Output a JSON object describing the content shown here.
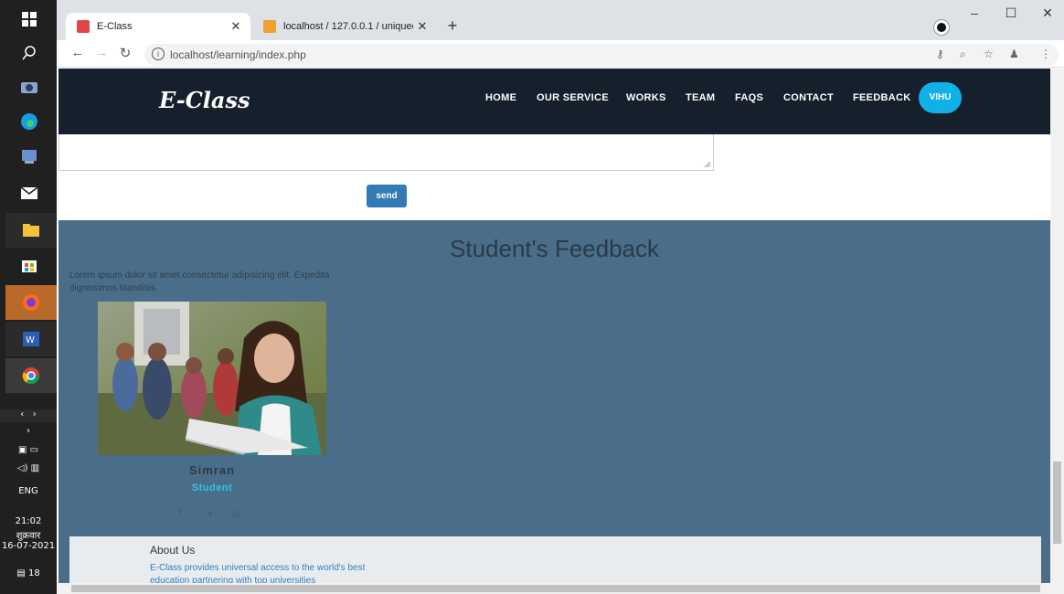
{
  "taskbar": {
    "icons": [
      "windows-icon",
      "search-icon",
      "camera-icon",
      "edge-icon",
      "app-icon",
      "mail-icon",
      "file-explorer-icon",
      "store-icon",
      "firefox-icon",
      "word-icon",
      "chrome-icon"
    ],
    "language": "ENG",
    "time": "21:02",
    "day": "शुक्रवार",
    "date": "16-07-2021",
    "notification_count": "18"
  },
  "browser": {
    "tabs": [
      {
        "title": "E-Class",
        "active": true
      },
      {
        "title": "localhost / 127.0.0.1 / uniquede…",
        "active": false
      }
    ],
    "url": "localhost/learning/index.php"
  },
  "site": {
    "logo": "E-Class",
    "nav": [
      "HOME",
      "OUR SERVICE",
      "WORKS",
      "TEAM",
      "FAQS",
      "CONTACT",
      "FEEDBACK"
    ],
    "user_button": "VIHU",
    "send_label": "send",
    "feedback": {
      "title": "Student's Feedback",
      "description": "Lorem ipsum dolor sit amet consectetur adipisicing elit. Expedita dignissimos blanditiis.",
      "name": "Simran",
      "role": "Student"
    },
    "about": {
      "title": "About Us",
      "text": "E-Class provides universal access to the world's best education partnering with top universities"
    }
  },
  "colors": {
    "nav_bg": "#16202d",
    "accent": "#0fb1e8",
    "feedback_bg": "#4a6e89",
    "send_button": "#337ab7"
  }
}
